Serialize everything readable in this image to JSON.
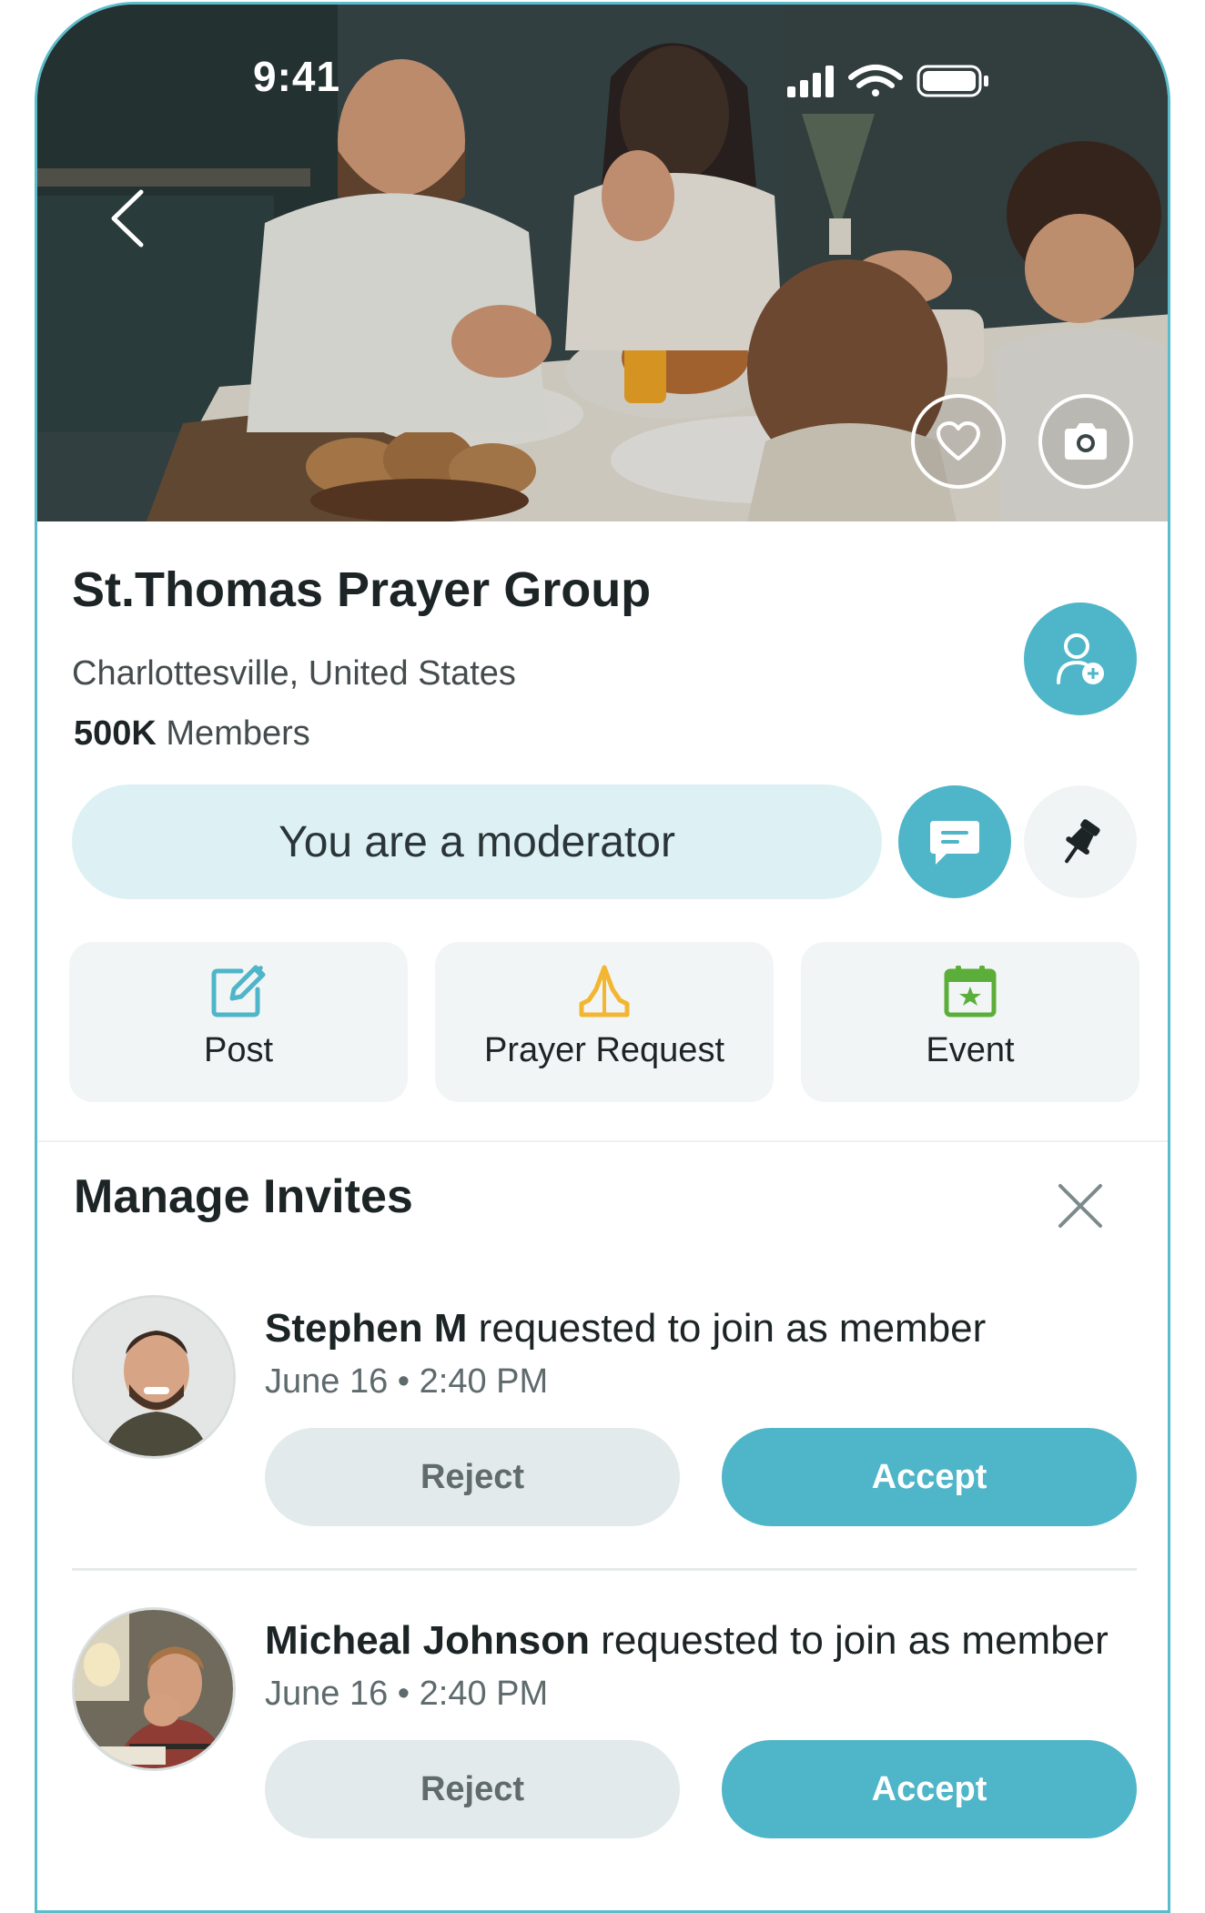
{
  "status_bar": {
    "time": "9:41"
  },
  "hero": {
    "icons": {
      "back": "chevron-left-icon",
      "favorite": "heart-icon",
      "camera": "camera-icon"
    }
  },
  "group": {
    "name": "St.Thomas Prayer Group",
    "location": "Charlottesville, United States",
    "members_count": "500K",
    "members_label": " Members"
  },
  "role_banner": "You are a moderator",
  "actions": [
    {
      "label": "Post",
      "icon": "edit-icon",
      "color": "#4fb5c8"
    },
    {
      "label": "Prayer Request",
      "icon": "praying-hands-icon",
      "color": "#f2b632"
    },
    {
      "label": "Event",
      "icon": "calendar-star-icon",
      "color": "#5cae3a"
    }
  ],
  "manage_invites": {
    "title": "Manage Invites",
    "invites": [
      {
        "name": "Stephen M",
        "message": " requested to join as member",
        "time": "June 16 • 2:40 PM",
        "reject_label": "Reject",
        "accept_label": "Accept"
      },
      {
        "name": "Micheal Johnson",
        "message": " requested to join as member",
        "time": "June 16 • 2:40 PM",
        "reject_label": "Reject",
        "accept_label": "Accept"
      }
    ]
  },
  "colors": {
    "accent": "#4fb5c8",
    "accent_light": "#ddf1f5",
    "border": "#5bbccc"
  }
}
